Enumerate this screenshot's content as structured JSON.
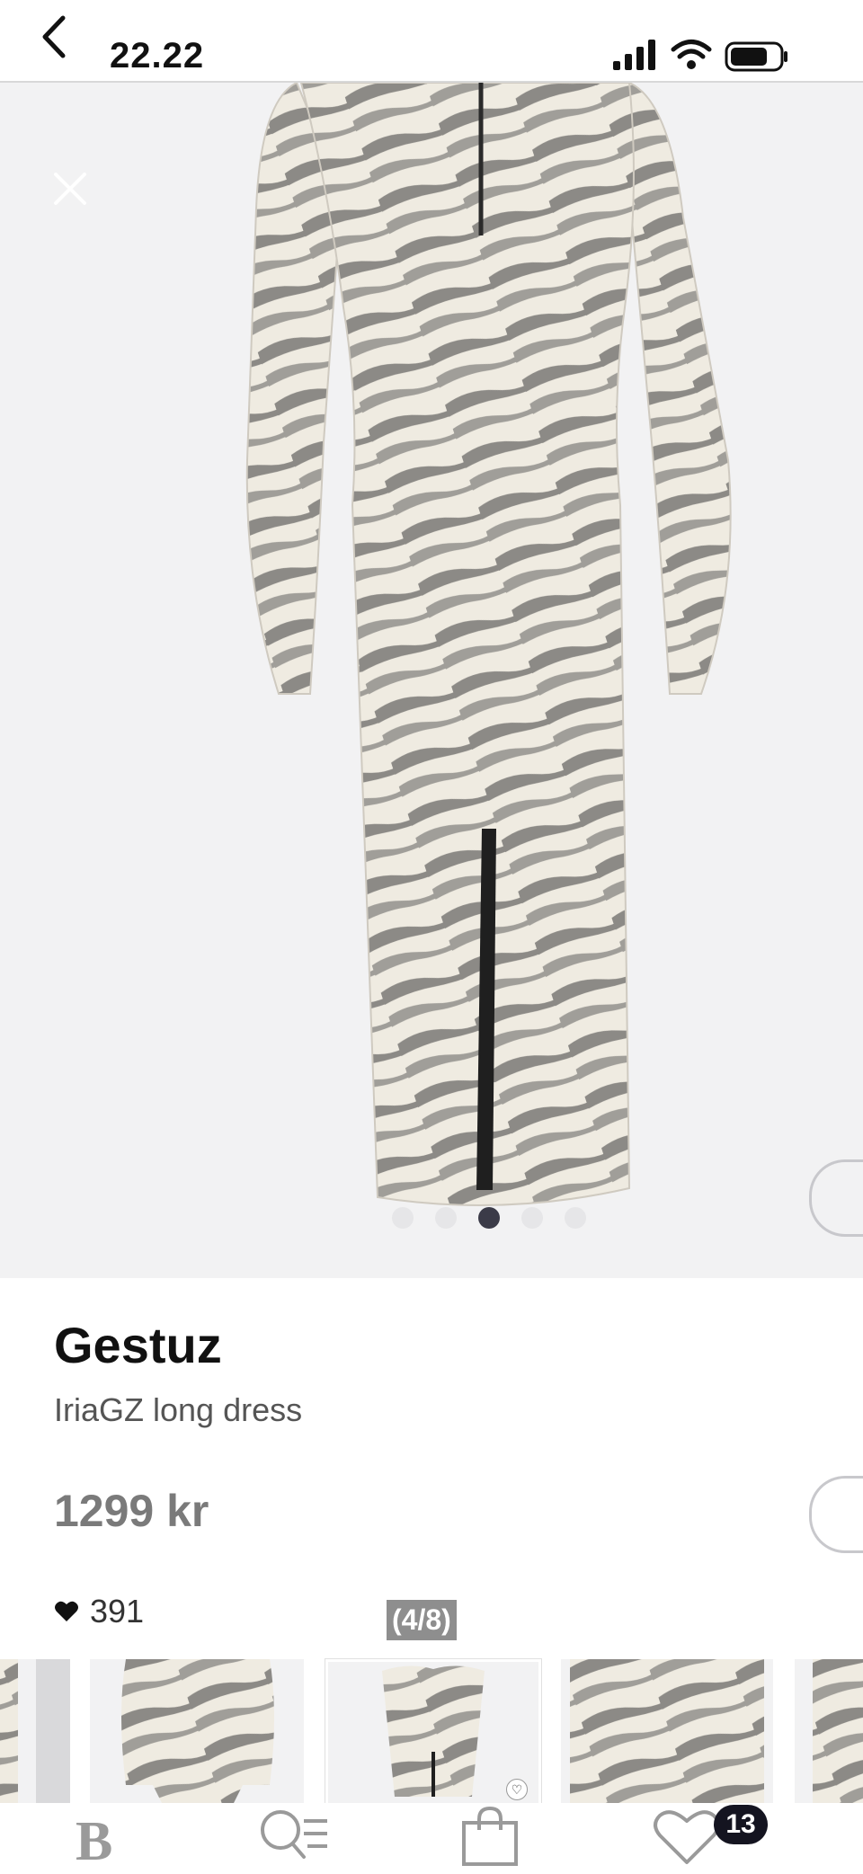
{
  "status_bar": {
    "time": "22.22",
    "icons": [
      "back-chevron-icon",
      "signal-icon",
      "wifi-icon",
      "battery-icon"
    ]
  },
  "gallery": {
    "slide_count": 5,
    "active_slide": 3,
    "close_icon": "close-icon",
    "counter_text": "(4/8)"
  },
  "product": {
    "brand": "Gestuz",
    "name": "IriaGZ long dress",
    "price": "1299 kr",
    "likes": "391"
  },
  "thumbnails": {
    "count": 5,
    "active_index": 2
  },
  "bottom_nav": {
    "logo": "B",
    "items": [
      "home-logo",
      "search-filter-icon",
      "bag-icon",
      "heart-icon"
    ],
    "favorites_badge": "13"
  },
  "colors": {
    "accent": "#141420",
    "image_bg": "#f2f2f3",
    "price": "#7a7a7a"
  }
}
